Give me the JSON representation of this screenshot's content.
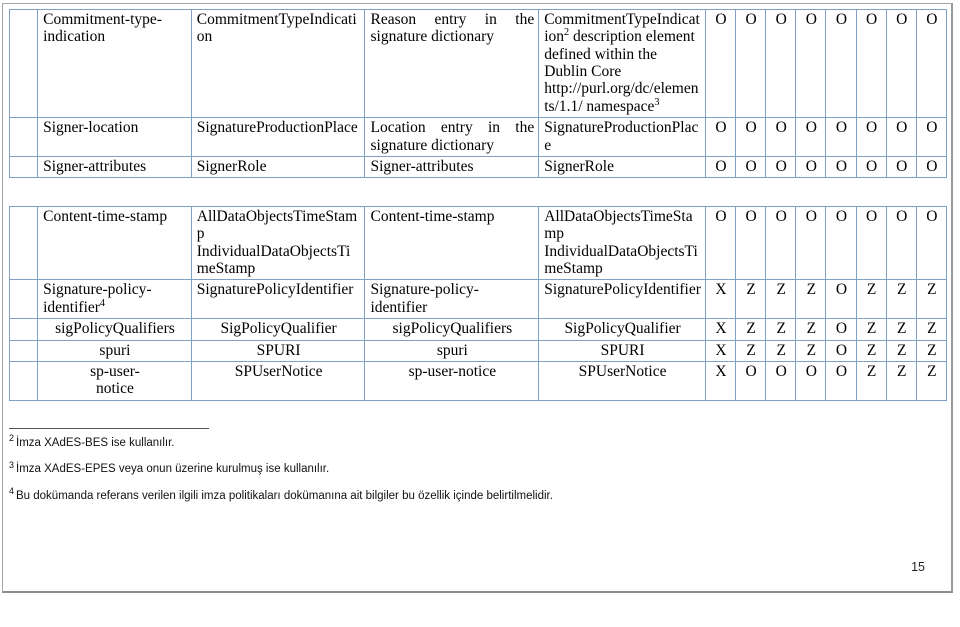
{
  "document": {
    "page_number": "15"
  },
  "table_upper": {
    "rows": [
      {
        "gutter": "",
        "col1": "Commitment-type-indication",
        "col1_sup": "",
        "col2": "CommitmentTypeIndication",
        "col3": "Reason entry in the signature dictionary",
        "col4": "CommitmentTypeIndication",
        "col4_sup": "2",
        "col4_tail": "description element defined within the Dublin Core http://purl.org/dc/elements/1.1/ namespace",
        "col4_tail_sup": "3",
        "marks": [
          "O",
          "O",
          "O",
          "O",
          "O",
          "O",
          "O",
          "O"
        ]
      },
      {
        "gutter": "",
        "col1": "Signer-location",
        "col2": "SignatureProductionPlace",
        "col3": "Location entry in the signature dictionary",
        "col4": "SignatureProductionPlace",
        "marks": [
          "O",
          "O",
          "O",
          "O",
          "O",
          "O",
          "O",
          "O"
        ]
      },
      {
        "gutter": "",
        "col1": "Signer-attributes",
        "col2": "SignerRole",
        "col3": "Signer-attributes",
        "col4": "SignerRole",
        "marks": [
          "O",
          "O",
          "O",
          "O",
          "O",
          "O",
          "O",
          "O"
        ]
      }
    ]
  },
  "table_lower": {
    "rows": [
      {
        "gutter": "",
        "col1": "Content-time-stamp",
        "col2": "AllDataObjectsTimeStamp IndividualDataObjectsTimeStamp",
        "col3": "Content-time-stamp",
        "col4": "AllDataObjectsTimeStamp IndividualDataObjectsTimeStamp",
        "marks": [
          "O",
          "O",
          "O",
          "O",
          "O",
          "O",
          "O",
          "O"
        ]
      },
      {
        "gutter": "",
        "col1": "Signature-policy-identifier",
        "col1_sup": "4",
        "col2": "SignaturePolicyIdentifier",
        "col3": "Signature-policy-identifier",
        "col4": "SignaturePolicyIdentifier",
        "marks": [
          "X",
          "Z",
          "Z",
          "Z",
          "O",
          "Z",
          "Z",
          "Z"
        ]
      },
      {
        "gutter": "",
        "col1": "sigPolicyQualifiers",
        "col2": "SigPolicyQualifier",
        "col3": "sigPolicyQualifiers",
        "col4": "SigPolicyQualifier",
        "indent": true,
        "marks": [
          "X",
          "Z",
          "Z",
          "Z",
          "O",
          "Z",
          "Z",
          "Z"
        ]
      },
      {
        "gutter": "",
        "col1": "spuri",
        "col2": "SPURI",
        "col3": "spuri",
        "col4": "SPURI",
        "indent": true,
        "marks": [
          "X",
          "Z",
          "Z",
          "Z",
          "O",
          "Z",
          "Z",
          "Z"
        ]
      },
      {
        "gutter": "",
        "col1": "sp-user-notice",
        "col2": "SPUserNotice",
        "col3": "sp-user-notice",
        "col4": "SPUserNotice",
        "indent": true,
        "marks": [
          "X",
          "O",
          "O",
          "O",
          "O",
          "Z",
          "Z",
          "Z"
        ]
      }
    ]
  },
  "footnotes": [
    {
      "marker": "2",
      "text": "İmza XAdES-BES ise kullanılır."
    },
    {
      "marker": "3",
      "text": "İmza XAdES-EPES veya onun üzerine kurulmuş ise kullanılır."
    },
    {
      "marker": "4",
      "text": "Bu dokümanda referans verilen ilgili imza politikaları dokümanına ait bilgiler bu özellik içinde belirtilmelidir."
    }
  ],
  "colors": {
    "grid_line": "#7f9fc4",
    "grid_line_heavy": "#5b84b1",
    "page_border": "#a6a6a6"
  }
}
